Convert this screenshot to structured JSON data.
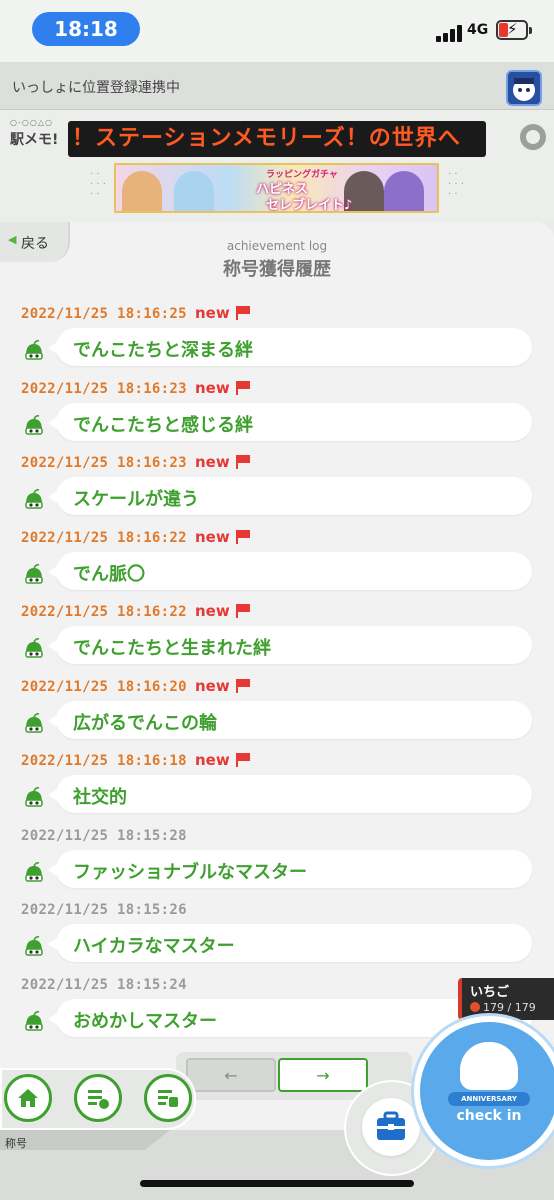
{
  "status": {
    "time": "18:18",
    "network": "4G"
  },
  "link_bar": {
    "text": "いっしょに位置登録連携中"
  },
  "header": {
    "logo_dots": "○-○○△○",
    "logo_text": "駅メモ!",
    "marquee": "！ステーションメモリーズ！の世界へ",
    "banner": {
      "line1": "ラッピングガチャ",
      "line2": "ハピネス",
      "line3": "セレブレイト♪"
    }
  },
  "nav": {
    "back_label": "戻る",
    "section_label": "称号"
  },
  "page": {
    "subtitle": "achievement log",
    "title": "称号獲得履歴"
  },
  "new_label": "new",
  "entries": [
    {
      "timestamp": "2022/11/25 18:16:25",
      "is_new": true,
      "title": "でんこたちと深まる絆"
    },
    {
      "timestamp": "2022/11/25 18:16:23",
      "is_new": true,
      "title": "でんこたちと感じる絆"
    },
    {
      "timestamp": "2022/11/25 18:16:23",
      "is_new": true,
      "title": "スケールが違う"
    },
    {
      "timestamp": "2022/11/25 18:16:22",
      "is_new": true,
      "title": "でん脈〇"
    },
    {
      "timestamp": "2022/11/25 18:16:22",
      "is_new": true,
      "title": "でんこたちと生まれた絆"
    },
    {
      "timestamp": "2022/11/25 18:16:20",
      "is_new": true,
      "title": "広がるでんこの輪"
    },
    {
      "timestamp": "2022/11/25 18:16:18",
      "is_new": true,
      "title": "社交的"
    },
    {
      "timestamp": "2022/11/25 18:15:28",
      "is_new": false,
      "title": "ファッショナブルなマスター"
    },
    {
      "timestamp": "2022/11/25 18:15:26",
      "is_new": false,
      "title": "ハイカラなマスター"
    },
    {
      "timestamp": "2022/11/25 18:15:24",
      "is_new": false,
      "title": "おめかしマスター"
    }
  ],
  "player": {
    "name": "いちご",
    "hp": "179 / 179"
  },
  "pager": {
    "prev": "←",
    "next": "→"
  },
  "checkin": {
    "label": "check in",
    "badge": "ANNIVERSARY"
  },
  "colors": {
    "accent_green": "#3ea02e",
    "new_orange": "#e0792a",
    "new_red": "#e53935",
    "checkin_blue": "#5aa9ea"
  }
}
